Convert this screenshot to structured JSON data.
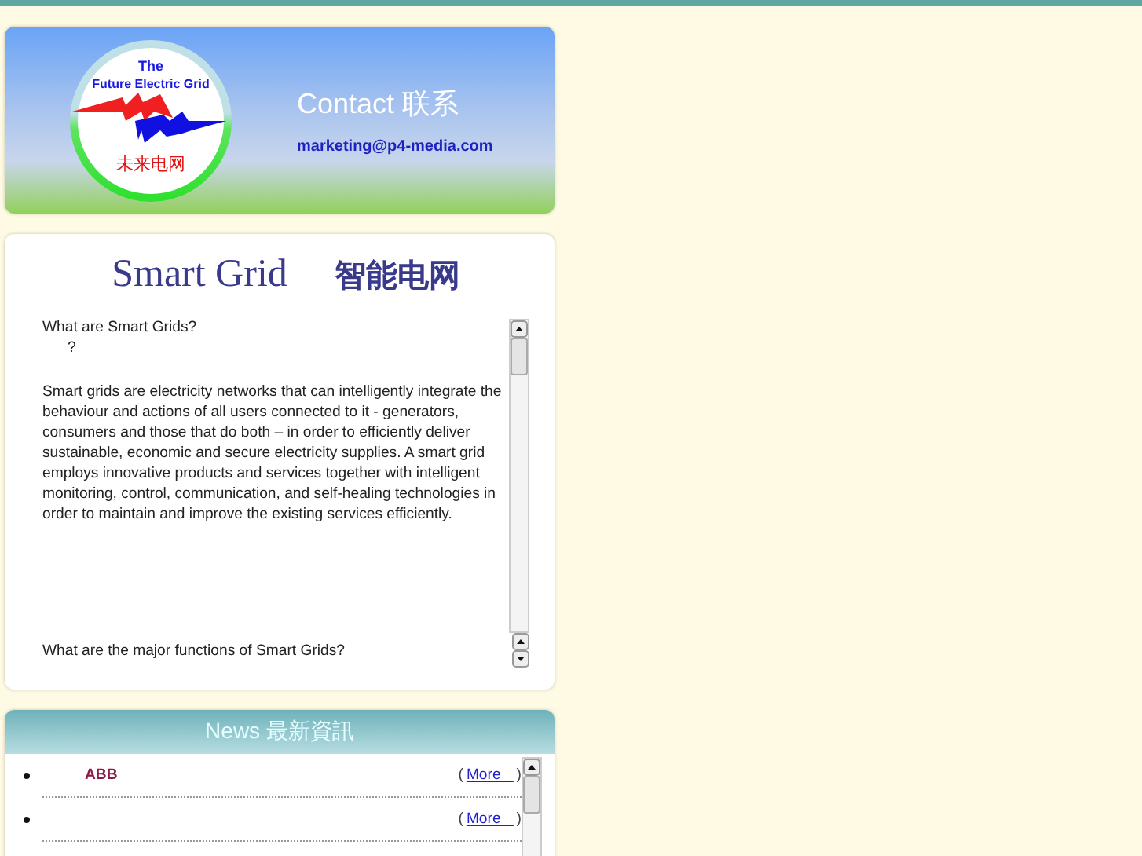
{
  "logo": {
    "line_1": "The",
    "line_2": "Future Electric Grid",
    "chinese": "未来电网"
  },
  "contact": {
    "title": "Contact 联系",
    "email": "marketing@p4-media.com"
  },
  "smart_grid": {
    "title": "Smart Grid",
    "title_chinese": "智能电网",
    "question": "What are Smart Grids?",
    "mark": "?",
    "answer": "Smart grids are electricity networks that can intelligently integrate the behaviour and actions of all users connected to it - generators, consumers and those that do both – in order to efficiently deliver sustainable, economic and secure electricity supplies. A smart grid employs innovative products and services together with intelligent monitoring, control, communication, and self-healing technologies in order to maintain and improve the existing services efficiently.",
    "next_question": "What are the major functions of Smart Grids?"
  },
  "news": {
    "title": "News 最新資訊",
    "items": [
      {
        "title": "ABB",
        "open": "(",
        "link": "More _",
        "close": ")"
      },
      {
        "open": "(",
        "link": "More _",
        "close": ")"
      }
    ]
  }
}
